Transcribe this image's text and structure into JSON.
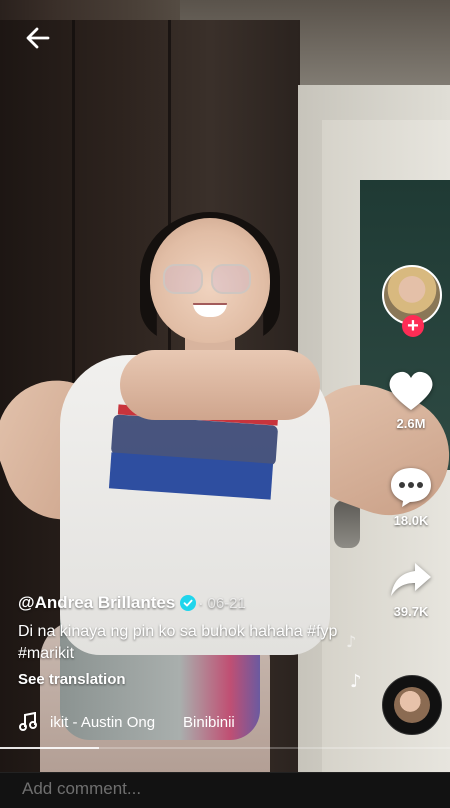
{
  "header": {
    "back_icon": "arrow-left-icon"
  },
  "creator": {
    "avatar_icon": "avatar",
    "follow_icon": "plus-icon",
    "follow_symbol": "+"
  },
  "actions": {
    "likes": {
      "icon": "heart-icon",
      "count": "2.6M"
    },
    "comments": {
      "icon": "comment-bubble-icon",
      "count": "18.0K"
    },
    "shares": {
      "icon": "share-arrow-icon",
      "count": "39.7K"
    }
  },
  "caption": {
    "username": "@Andrea Brillantes",
    "date": " · 06-21",
    "text": "Di na kinaya ng pin ko sa buhok hahaha #fyp #marikit",
    "see_translation": "See translation"
  },
  "music": {
    "icon": "music-note-icon",
    "title": "ikit - Austin Ong",
    "title_continued": "Binibinii"
  },
  "playback": {
    "progress": 0.22
  },
  "comment": {
    "placeholder": "Add comment..."
  },
  "colors": {
    "accent": "#fe2c55",
    "verified": "#20d5ec"
  }
}
